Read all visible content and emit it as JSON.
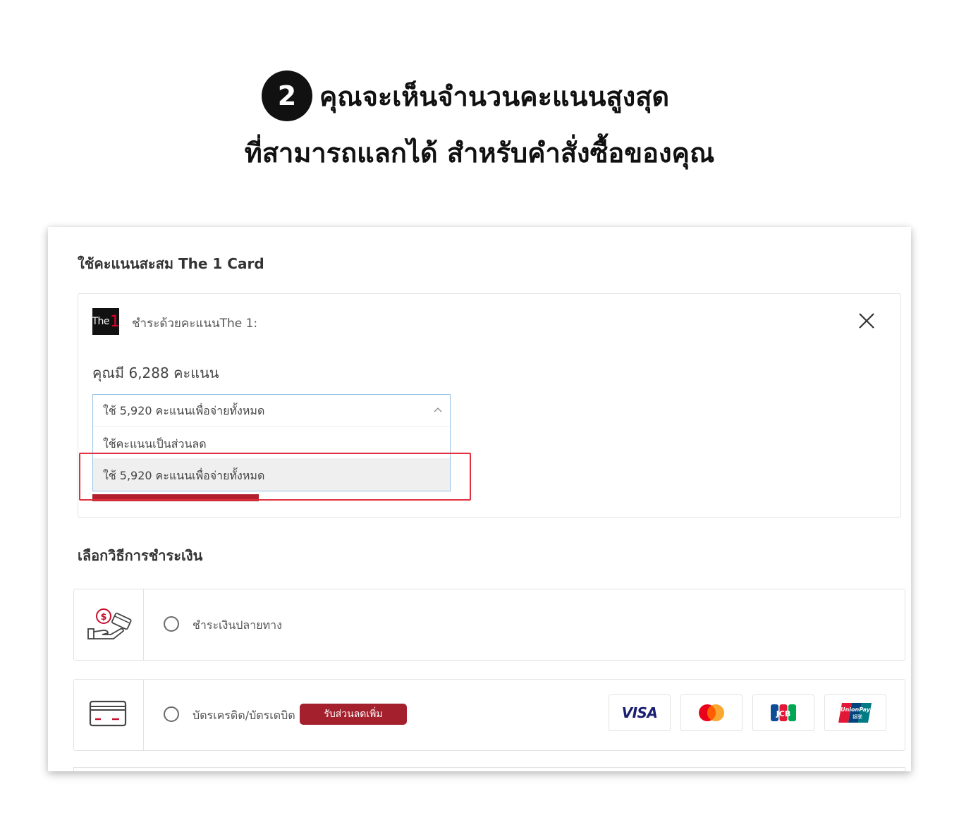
{
  "heading": {
    "step_number": "2",
    "line1": "คุณจะเห็นจำนวนคะแนนสูงสุด",
    "line2": "ที่สามารถแลกได้ สำหรับคำสั่งซื้อของคุณ"
  },
  "points_section": {
    "title": "ใช้คะแนนสะสม The 1 Card",
    "logo_text": "The",
    "logo_mark": "1",
    "pay_label": "ชำระด้วยคะแนนThe 1:",
    "points_text": "คุณมี 6,288 คะแนน",
    "select": {
      "current": "ใช้ 5,920 คะแนนเพื่อจ่ายทั้งหมด",
      "options": [
        "ใช้คะแนนเป็นส่วนลด",
        "ใช้ 5,920 คะแนนเพื่อจ่ายทั้งหมด"
      ]
    }
  },
  "payment_section": {
    "title": "เลือกวิธีการชำระเงิน",
    "methods": [
      {
        "label": "ชำระเงินปลายทาง",
        "icon": "cash-on-delivery-icon"
      },
      {
        "label": "บัตรเครดิต/บัตรเดบิต",
        "icon": "credit-card-icon",
        "badge": "รับส่วนลดเพิ่ม"
      }
    ],
    "brands": {
      "visa": "VISA",
      "mastercard": "mastercard-icon",
      "jcb": "JCB",
      "unionpay_top": "UnionPay",
      "unionpay_bottom": "银联"
    }
  },
  "colors": {
    "accent_red": "#a3202c",
    "highlight_red": "#e0303d",
    "select_border": "#9cc3e6"
  }
}
